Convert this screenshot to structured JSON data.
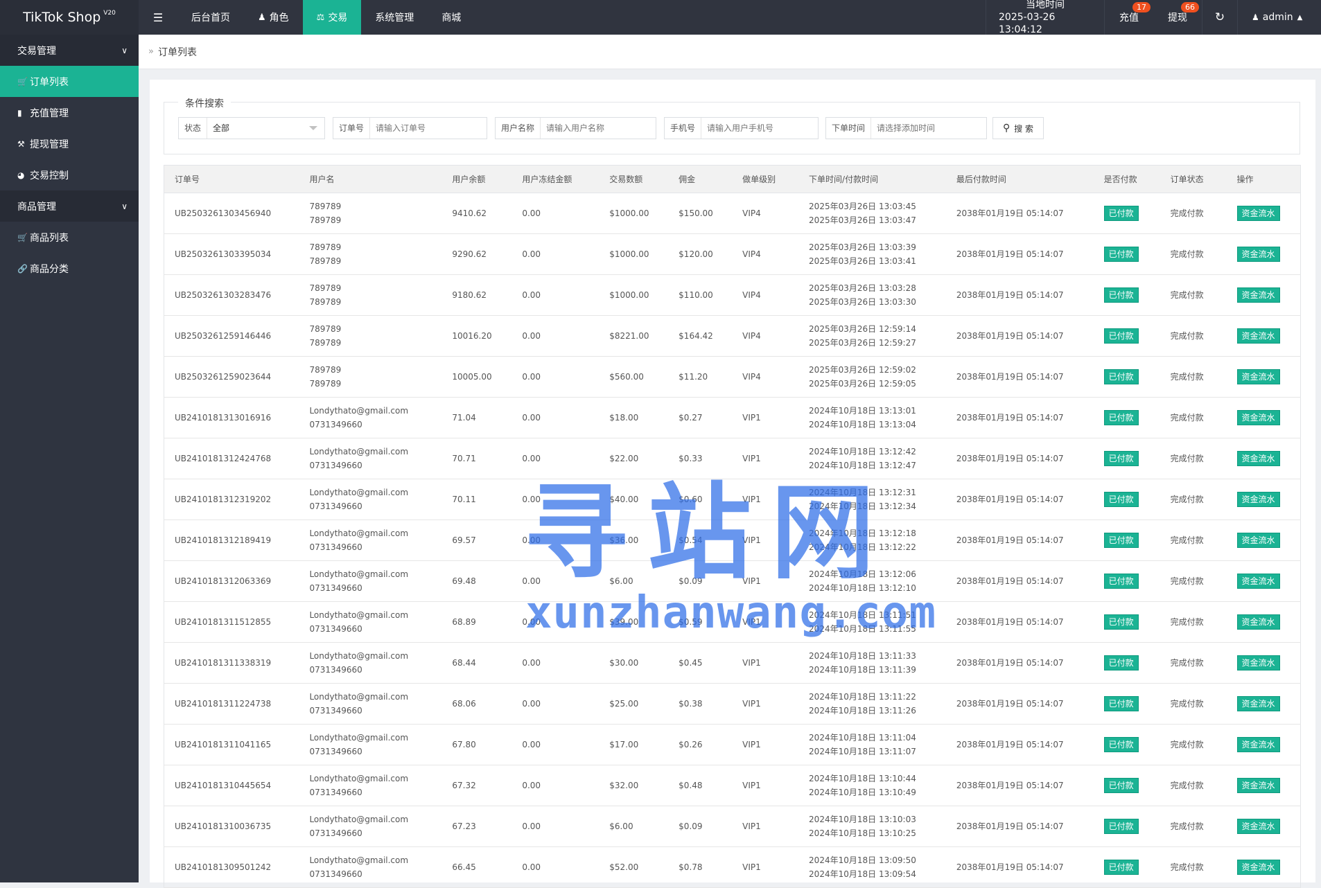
{
  "brand": {
    "name": "TikTok Shop",
    "version": "V20"
  },
  "topnav": {
    "toggle_icon": "☰",
    "items": [
      {
        "label": "后台首页",
        "icon": ""
      },
      {
        "label": "角色",
        "icon": "user-icon"
      },
      {
        "label": "交易",
        "icon": "scale-icon",
        "active": true
      },
      {
        "label": "系统管理",
        "icon": ""
      },
      {
        "label": "商城",
        "icon": ""
      }
    ]
  },
  "header_right": {
    "time_label": "当地时间",
    "time_value": "2025-03-26 13:04:12",
    "charge_label": "充值",
    "charge_badge": "17",
    "withdraw_label": "提现",
    "withdraw_badge": "66",
    "user_label": "admin"
  },
  "sidebar": {
    "groups": [
      {
        "label": "交易管理",
        "items": [
          "订单列表",
          "充值管理",
          "提现管理",
          "交易控制"
        ]
      },
      {
        "label": "商品管理",
        "items": [
          "商品列表",
          "商品分类"
        ]
      }
    ]
  },
  "breadcrumb": {
    "tab": "订单列表"
  },
  "search": {
    "legend": "条件搜索",
    "status_label": "状态",
    "status_value": "全部",
    "order_label": "订单号",
    "order_placeholder": "请输入订单号",
    "user_label": "用户名称",
    "user_placeholder": "请输入用户名称",
    "phone_label": "手机号",
    "phone_placeholder": "请输入用户手机号",
    "time_label": "下单时间",
    "time_placeholder": "请选择添加时间",
    "button_label": "搜 索"
  },
  "table": {
    "headers": [
      "订单号",
      "用户名",
      "用户余额",
      "用户冻结金额",
      "交易数额",
      "佣金",
      "做单级别",
      "下单时间/付款时间",
      "最后付款时间",
      "是否付款",
      "订单状态",
      "操作"
    ],
    "rows": [
      {
        "order": "UB2503261303456940",
        "user1": "789789",
        "user2": "789789",
        "balance": "9410.62",
        "frozen": "0.00",
        "amount": "$1000.00",
        "commission": "$150.00",
        "level": "VIP4",
        "t1": "2025年03月26日 13:03:45",
        "t2": "2025年03月26日 13:03:47",
        "last": "2038年01月19日 05:14:07",
        "paid": "已付款",
        "status": "完成付款",
        "op": "资金流水"
      },
      {
        "order": "UB2503261303395034",
        "user1": "789789",
        "user2": "789789",
        "balance": "9290.62",
        "frozen": "0.00",
        "amount": "$1000.00",
        "commission": "$120.00",
        "level": "VIP4",
        "t1": "2025年03月26日 13:03:39",
        "t2": "2025年03月26日 13:03:41",
        "last": "2038年01月19日 05:14:07",
        "paid": "已付款",
        "status": "完成付款",
        "op": "资金流水"
      },
      {
        "order": "UB2503261303283476",
        "user1": "789789",
        "user2": "789789",
        "balance": "9180.62",
        "frozen": "0.00",
        "amount": "$1000.00",
        "commission": "$110.00",
        "level": "VIP4",
        "t1": "2025年03月26日 13:03:28",
        "t2": "2025年03月26日 13:03:30",
        "last": "2038年01月19日 05:14:07",
        "paid": "已付款",
        "status": "完成付款",
        "op": "资金流水"
      },
      {
        "order": "UB2503261259146446",
        "user1": "789789",
        "user2": "789789",
        "balance": "10016.20",
        "frozen": "0.00",
        "amount": "$8221.00",
        "commission": "$164.42",
        "level": "VIP4",
        "t1": "2025年03月26日 12:59:14",
        "t2": "2025年03月26日 12:59:27",
        "last": "2038年01月19日 05:14:07",
        "paid": "已付款",
        "status": "完成付款",
        "op": "资金流水"
      },
      {
        "order": "UB2503261259023644",
        "user1": "789789",
        "user2": "789789",
        "balance": "10005.00",
        "frozen": "0.00",
        "amount": "$560.00",
        "commission": "$11.20",
        "level": "VIP4",
        "t1": "2025年03月26日 12:59:02",
        "t2": "2025年03月26日 12:59:05",
        "last": "2038年01月19日 05:14:07",
        "paid": "已付款",
        "status": "完成付款",
        "op": "资金流水"
      },
      {
        "order": "UB2410181313016916",
        "user1": "Londythato@gmail.com",
        "user2": "0731349660",
        "balance": "71.04",
        "frozen": "0.00",
        "amount": "$18.00",
        "commission": "$0.27",
        "level": "VIP1",
        "t1": "2024年10月18日 13:13:01",
        "t2": "2024年10月18日 13:13:04",
        "last": "2038年01月19日 05:14:07",
        "paid": "已付款",
        "status": "完成付款",
        "op": "资金流水"
      },
      {
        "order": "UB2410181312424768",
        "user1": "Londythato@gmail.com",
        "user2": "0731349660",
        "balance": "70.71",
        "frozen": "0.00",
        "amount": "$22.00",
        "commission": "$0.33",
        "level": "VIP1",
        "t1": "2024年10月18日 13:12:42",
        "t2": "2024年10月18日 13:12:47",
        "last": "2038年01月19日 05:14:07",
        "paid": "已付款",
        "status": "完成付款",
        "op": "资金流水"
      },
      {
        "order": "UB2410181312319202",
        "user1": "Londythato@gmail.com",
        "user2": "0731349660",
        "balance": "70.11",
        "frozen": "0.00",
        "amount": "$40.00",
        "commission": "$0.60",
        "level": "VIP1",
        "t1": "2024年10月18日 13:12:31",
        "t2": "2024年10月18日 13:12:34",
        "last": "2038年01月19日 05:14:07",
        "paid": "已付款",
        "status": "完成付款",
        "op": "资金流水"
      },
      {
        "order": "UB2410181312189419",
        "user1": "Londythato@gmail.com",
        "user2": "0731349660",
        "balance": "69.57",
        "frozen": "0.00",
        "amount": "$36.00",
        "commission": "$0.54",
        "level": "VIP1",
        "t1": "2024年10月18日 13:12:18",
        "t2": "2024年10月18日 13:12:22",
        "last": "2038年01月19日 05:14:07",
        "paid": "已付款",
        "status": "完成付款",
        "op": "资金流水"
      },
      {
        "order": "UB2410181312063369",
        "user1": "Londythato@gmail.com",
        "user2": "0731349660",
        "balance": "69.48",
        "frozen": "0.00",
        "amount": "$6.00",
        "commission": "$0.09",
        "level": "VIP1",
        "t1": "2024年10月18日 13:12:06",
        "t2": "2024年10月18日 13:12:10",
        "last": "2038年01月19日 05:14:07",
        "paid": "已付款",
        "status": "完成付款",
        "op": "资金流水"
      },
      {
        "order": "UB2410181311512855",
        "user1": "Londythato@gmail.com",
        "user2": "0731349660",
        "balance": "68.89",
        "frozen": "0.00",
        "amount": "$39.00",
        "commission": "$0.59",
        "level": "VIP1",
        "t1": "2024年10月18日 13:11:51",
        "t2": "2024年10月18日 13:11:55",
        "last": "2038年01月19日 05:14:07",
        "paid": "已付款",
        "status": "完成付款",
        "op": "资金流水"
      },
      {
        "order": "UB2410181311338319",
        "user1": "Londythato@gmail.com",
        "user2": "0731349660",
        "balance": "68.44",
        "frozen": "0.00",
        "amount": "$30.00",
        "commission": "$0.45",
        "level": "VIP1",
        "t1": "2024年10月18日 13:11:33",
        "t2": "2024年10月18日 13:11:39",
        "last": "2038年01月19日 05:14:07",
        "paid": "已付款",
        "status": "完成付款",
        "op": "资金流水"
      },
      {
        "order": "UB2410181311224738",
        "user1": "Londythato@gmail.com",
        "user2": "0731349660",
        "balance": "68.06",
        "frozen": "0.00",
        "amount": "$25.00",
        "commission": "$0.38",
        "level": "VIP1",
        "t1": "2024年10月18日 13:11:22",
        "t2": "2024年10月18日 13:11:26",
        "last": "2038年01月19日 05:14:07",
        "paid": "已付款",
        "status": "完成付款",
        "op": "资金流水"
      },
      {
        "order": "UB2410181311041165",
        "user1": "Londythato@gmail.com",
        "user2": "0731349660",
        "balance": "67.80",
        "frozen": "0.00",
        "amount": "$17.00",
        "commission": "$0.26",
        "level": "VIP1",
        "t1": "2024年10月18日 13:11:04",
        "t2": "2024年10月18日 13:11:07",
        "last": "2038年01月19日 05:14:07",
        "paid": "已付款",
        "status": "完成付款",
        "op": "资金流水"
      },
      {
        "order": "UB2410181310445654",
        "user1": "Londythato@gmail.com",
        "user2": "0731349660",
        "balance": "67.32",
        "frozen": "0.00",
        "amount": "$32.00",
        "commission": "$0.48",
        "level": "VIP1",
        "t1": "2024年10月18日 13:10:44",
        "t2": "2024年10月18日 13:10:49",
        "last": "2038年01月19日 05:14:07",
        "paid": "已付款",
        "status": "完成付款",
        "op": "资金流水"
      },
      {
        "order": "UB2410181310036735",
        "user1": "Londythato@gmail.com",
        "user2": "0731349660",
        "balance": "67.23",
        "frozen": "0.00",
        "amount": "$6.00",
        "commission": "$0.09",
        "level": "VIP1",
        "t1": "2024年10月18日 13:10:03",
        "t2": "2024年10月18日 13:10:25",
        "last": "2038年01月19日 05:14:07",
        "paid": "已付款",
        "status": "完成付款",
        "op": "资金流水"
      },
      {
        "order": "UB2410181309501242",
        "user1": "Londythato@gmail.com",
        "user2": "0731349660",
        "balance": "66.45",
        "frozen": "0.00",
        "amount": "$52.00",
        "commission": "$0.78",
        "level": "VIP1",
        "t1": "2024年10月18日 13:09:50",
        "t2": "2024年10月18日 13:09:54",
        "last": "2038年01月19日 05:14:07",
        "paid": "已付款",
        "status": "完成付款",
        "op": "资金流水"
      }
    ]
  },
  "watermark": {
    "cn": "寻站网",
    "en": "xunzhanwang.com"
  },
  "colors": {
    "accent": "#1bb394",
    "topbar": "#30343f",
    "sidebar": "#2f3440",
    "badge": "#f0501f",
    "watermark": "#2f6ee8"
  }
}
